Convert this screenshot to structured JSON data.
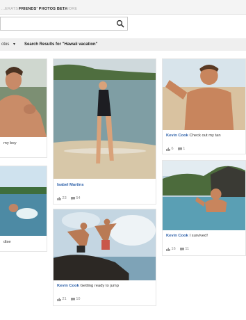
{
  "nav": {
    "tabs": [
      "...ERATS",
      "FRIENDS' PHOTOS BETA",
      "MORE"
    ]
  },
  "search": {
    "value": "",
    "placeholder": ""
  },
  "filter": {
    "dropdown_label": "otos",
    "results_label": "Search Results for \"Hawaii vacation\""
  },
  "cards": [
    {
      "author": "",
      "text": "my boy",
      "likes": "",
      "comments": ""
    },
    {
      "author": "",
      "text": "dise",
      "likes": "",
      "comments": ""
    },
    {
      "author": "Isabel Martins",
      "text": "",
      "likes": "23",
      "comments": "54"
    },
    {
      "author": "Kevin Cook",
      "text": "Getting ready to jump",
      "likes": "21",
      "comments": "10"
    },
    {
      "author": "Kevin Cook",
      "text": "Check out my tan",
      "likes": "6",
      "comments": "1"
    },
    {
      "author": "Kevin Cook",
      "text": "I survived!",
      "likes": "16",
      "comments": "11"
    }
  ]
}
